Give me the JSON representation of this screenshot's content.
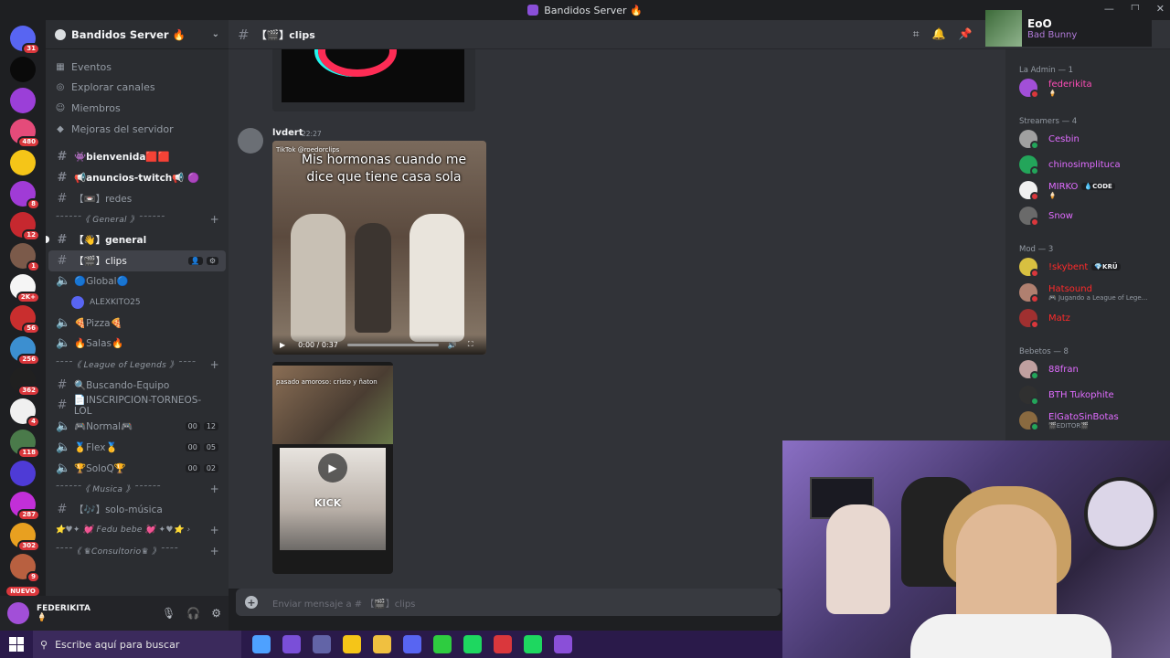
{
  "window": {
    "title": "Bandidos Server 🔥"
  },
  "rail": {
    "servers": [
      {
        "badge": "31",
        "color": "#5865f2"
      },
      {
        "badge": "",
        "color": "#0a0a0a"
      },
      {
        "badge": "",
        "color": "#9b3fd8"
      },
      {
        "badge": "480",
        "color": "#e54b7a"
      },
      {
        "badge": "",
        "color": "#f5c518"
      },
      {
        "badge": "8",
        "color": "#a03bd6"
      },
      {
        "badge": "12",
        "color": "#c6282f"
      },
      {
        "badge": "1",
        "color": "#7b5a4a"
      },
      {
        "badge": "2K+",
        "color": "#f5f5f5"
      },
      {
        "badge": "56",
        "color": "#c92e2e"
      },
      {
        "badge": "256",
        "color": "#3c8fd0"
      },
      {
        "badge": "362",
        "color": "#202020"
      },
      {
        "badge": "4",
        "color": "#f0f0f0"
      },
      {
        "badge": "118",
        "color": "#4a7a4a"
      },
      {
        "badge": "",
        "color": "#4e3bd6"
      },
      {
        "badge": "287",
        "color": "#c22fd8"
      },
      {
        "badge": "302",
        "color": "#e8a020"
      },
      {
        "badge": "9",
        "color": "#b86040"
      },
      {
        "badge": "",
        "color": "#6a6a6a"
      }
    ],
    "new_label": "NUEVO"
  },
  "sidebar": {
    "server_name": "Bandidos Server 🔥",
    "nav": [
      {
        "label": "Eventos",
        "icon": "calendar-icon"
      },
      {
        "label": "Explorar canales",
        "icon": "compass-icon"
      },
      {
        "label": "Miembros",
        "icon": "members-icon"
      },
      {
        "label": "Mejoras del servidor",
        "icon": "boost-icon"
      }
    ],
    "channels": [
      {
        "type": "text",
        "label": "👾bienvenida🟥🟥",
        "bold": true
      },
      {
        "type": "text",
        "label": "📢anuncios-twitch📢 🟣",
        "bold": true
      },
      {
        "type": "text",
        "label": "【📼】redes"
      },
      {
        "type": "category",
        "label": "˜˜˜˜˜˜《 General 》˜˜˜˜˜˜"
      },
      {
        "type": "text",
        "label": "【👋】general",
        "bold": true,
        "dot": true
      },
      {
        "type": "text",
        "label": "【🎬】clips",
        "active": true
      },
      {
        "type": "voice",
        "label": "🔵Global🔵"
      },
      {
        "type": "voice-user",
        "label": "ALEXKITO25"
      },
      {
        "type": "voice",
        "label": "🍕Pizza🍕"
      },
      {
        "type": "voice",
        "label": "🔥Salas🔥"
      },
      {
        "type": "category",
        "label": "˜˜˜˜《 League of Legends 》˜˜˜˜"
      },
      {
        "type": "text",
        "label": "🔍Buscando-Equipo"
      },
      {
        "type": "text",
        "label": "📄INSCRIPCION-TORNEOS-LOL"
      },
      {
        "type": "voice",
        "label": "🎮Normal🎮",
        "counts": [
          "00",
          "12"
        ]
      },
      {
        "type": "voice",
        "label": "🥇Flex🥇",
        "counts": [
          "00",
          "05"
        ]
      },
      {
        "type": "voice",
        "label": "🏆SoloQ🏆",
        "counts": [
          "00",
          "02"
        ]
      },
      {
        "type": "category",
        "label": "˜˜˜˜˜˜《 Musica 》˜˜˜˜˜˜"
      },
      {
        "type": "text",
        "label": "【🎶】solo-música"
      },
      {
        "type": "category",
        "label": "⭐♥✦ 💓 Fedu bebe 💓 ✦♥⭐ ›"
      },
      {
        "type": "category",
        "label": "˜˜˜˜《 ♛Consultorio♛ 》˜˜˜˜"
      }
    ]
  },
  "user_panel": {
    "name": "FEDERIKITA",
    "status": "🍦"
  },
  "channel_header": {
    "name": "【🎬】clips"
  },
  "message": {
    "author": "lvdert",
    "time": "22:27",
    "video": {
      "caption": "Mis hormonas cuando me dice que tiene casa sola",
      "watermark": "TikTok @roedorclips",
      "time": "0:00 / 0:37"
    },
    "gif": {
      "top_text": "pasado amoroso: cristo y ñaton",
      "brand": "KICK"
    }
  },
  "composer": {
    "placeholder": "Enviar mensaje a # 【🎬】clips"
  },
  "now_playing": {
    "title": "EoO",
    "artist": "Bad Bunny"
  },
  "members": {
    "groups": [
      {
        "label": "La Admin — 1",
        "items": [
          {
            "name": "federikita",
            "sub": "🍦",
            "color": "#ff4db8",
            "av": "#a24fd8",
            "status": "#da373c"
          }
        ]
      },
      {
        "label": "Streamers — 4",
        "items": [
          {
            "name": "Cesbin",
            "color": "#e06cff",
            "av": "#a0a0a0",
            "status": "#23a55a"
          },
          {
            "name": "chinosimplituca",
            "color": "#e06cff",
            "av": "#23a55a",
            "status": "#23a55a"
          },
          {
            "name": "MIRKO",
            "tag": "💧CODE",
            "sub": "🍦",
            "color": "#e06cff",
            "av": "#f0f0f0",
            "status": "#da373c"
          },
          {
            "name": "Snow",
            "color": "#e06cff",
            "av": "#6a6a6a",
            "status": "#da373c"
          }
        ]
      },
      {
        "label": "Mod — 3",
        "items": [
          {
            "name": "!skybent",
            "tag": "💎KRÜ",
            "color": "#ff2a2a",
            "av": "#d8c040",
            "status": "#da373c"
          },
          {
            "name": "Hatsound",
            "sub": "🎮 Jugando a League of Lege...",
            "color": "#ff2a2a",
            "av": "#b08070",
            "status": "#da373c"
          },
          {
            "name": "Matz",
            "color": "#ff2a2a",
            "av": "#a03030",
            "status": "#da373c"
          }
        ]
      },
      {
        "label": "Bebetos — 8",
        "items": [
          {
            "name": "88fran",
            "color": "#e06cff",
            "av": "#c0a0a0",
            "status": "#23a55a"
          },
          {
            "name": "BTH Tukophite",
            "color": "#e06cff",
            "av": "#303030",
            "status": "#23a55a"
          },
          {
            "name": "ElGatoSinBotas",
            "sub": "🎬EDITOR🎬",
            "color": "#e06cff",
            "av": "#8a6a40",
            "status": "#23a55a"
          }
        ]
      }
    ]
  },
  "taskbar": {
    "search_placeholder": "Escribe aquí para buscar",
    "apps": [
      "#4ea1ff",
      "#7a4fd8",
      "#6264a7",
      "#f5c518",
      "#f0c040",
      "#5865f2",
      "#2ecc40",
      "#1ed760",
      "#da373c",
      "#1ed760",
      "#8a4fd8"
    ]
  }
}
